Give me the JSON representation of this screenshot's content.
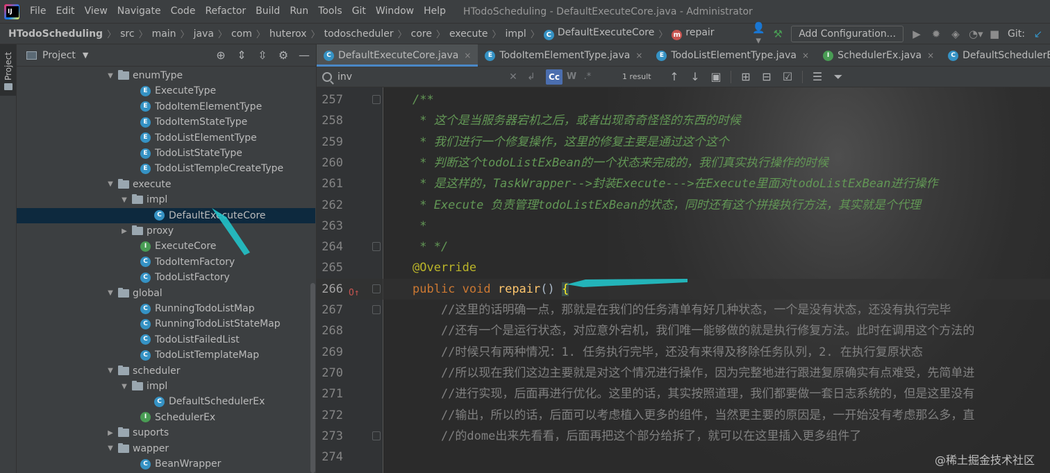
{
  "menu": {
    "items": [
      "File",
      "Edit",
      "View",
      "Navigate",
      "Code",
      "Refactor",
      "Build",
      "Run",
      "Tools",
      "Git",
      "Window",
      "Help"
    ],
    "window_title": "HTodoScheduling - DefaultExecuteCore.java - Administrator"
  },
  "navbar": {
    "crumbs": [
      "HTodoScheduling",
      "src",
      "main",
      "java",
      "com",
      "huterox",
      "todoscheduler",
      "core",
      "execute",
      "impl"
    ],
    "class_crumb": "DefaultExecuteCore",
    "method_crumb": "repair",
    "add_config_label": "Add Configuration...",
    "git_label": "Git:"
  },
  "left_strip": {
    "project_label": "Project"
  },
  "project_panel": {
    "title": "Project",
    "tree": [
      {
        "label": "enumType",
        "kind": "folder",
        "depth": 1,
        "expanded": true
      },
      {
        "label": "ExecuteType",
        "kind": "E",
        "depth": 2
      },
      {
        "label": "TodoItemElementType",
        "kind": "E",
        "depth": 2
      },
      {
        "label": "TodoItemStateType",
        "kind": "E",
        "depth": 2
      },
      {
        "label": "TodoListElementType",
        "kind": "E",
        "depth": 2
      },
      {
        "label": "TodoListStateType",
        "kind": "E",
        "depth": 2
      },
      {
        "label": "TodoListTempleCreateType",
        "kind": "E",
        "depth": 2
      },
      {
        "label": "execute",
        "kind": "folder",
        "depth": 1,
        "expanded": true
      },
      {
        "label": "impl",
        "kind": "folder",
        "depth": 2,
        "expanded": true
      },
      {
        "label": "DefaultExecuteCore",
        "kind": "C",
        "depth": 3,
        "selected": true
      },
      {
        "label": "proxy",
        "kind": "folder",
        "depth": 2,
        "expanded": false
      },
      {
        "label": "ExecuteCore",
        "kind": "I",
        "depth": 2
      },
      {
        "label": "TodoItemFactory",
        "kind": "C",
        "depth": 2
      },
      {
        "label": "TodoListFactory",
        "kind": "C",
        "depth": 2
      },
      {
        "label": "global",
        "kind": "folder",
        "depth": 1,
        "expanded": true
      },
      {
        "label": "RunningTodoListMap",
        "kind": "C",
        "depth": 2
      },
      {
        "label": "RunningTodoListStateMap",
        "kind": "C",
        "depth": 2
      },
      {
        "label": "TodoListFailedList",
        "kind": "C",
        "depth": 2
      },
      {
        "label": "TodoListTemplateMap",
        "kind": "C",
        "depth": 2
      },
      {
        "label": "scheduler",
        "kind": "folder",
        "depth": 1,
        "expanded": true
      },
      {
        "label": "impl",
        "kind": "folder",
        "depth": 2,
        "expanded": true
      },
      {
        "label": "DefaultSchedulerEx",
        "kind": "C",
        "depth": 3
      },
      {
        "label": "SchedulerEx",
        "kind": "I",
        "depth": 2
      },
      {
        "label": "suports",
        "kind": "folder",
        "depth": 1,
        "expanded": false
      },
      {
        "label": "wapper",
        "kind": "folder",
        "depth": 1,
        "expanded": true
      },
      {
        "label": "BeanWrapper",
        "kind": "C",
        "depth": 2
      }
    ]
  },
  "editor": {
    "tabs": [
      {
        "label": "DefaultExecuteCore.java",
        "kind": "C",
        "active": true
      },
      {
        "label": "TodoItemElementType.java",
        "kind": "E"
      },
      {
        "label": "TodoListElementType.java",
        "kind": "E"
      },
      {
        "label": "SchedulerEx.java",
        "kind": "I"
      },
      {
        "label": "DefaultSchedulerEx.java",
        "kind": "C"
      }
    ],
    "search": {
      "value": "inv",
      "match_case_label": "Cc",
      "words_label": "W",
      "regex_label": ".*",
      "result": "1 result"
    },
    "lines": [
      {
        "num": "257",
        "fold": true,
        "parts": [
          {
            "t": "/**",
            "c": "c-comment"
          }
        ]
      },
      {
        "num": "258",
        "parts": [
          {
            "t": " * 这个是当服务器宕机之后，或者出现奇奇怪怪的东西的时候",
            "c": "c-comment"
          }
        ]
      },
      {
        "num": "259",
        "parts": [
          {
            "t": " * 我们进行一个修复操作，这里的修复主要是通过这个这个",
            "c": "c-comment"
          }
        ]
      },
      {
        "num": "260",
        "parts": [
          {
            "t": " * 判断这个todoListExBean的一个状态来完成的，我们真实执行操作的时候",
            "c": "c-comment"
          }
        ]
      },
      {
        "num": "261",
        "parts": [
          {
            "t": " * 是这样的，TaskWrapper-->封装Execute--->在Execute里面对todoListExBean进行操作",
            "c": "c-comment"
          }
        ]
      },
      {
        "num": "262",
        "parts": [
          {
            "t": " * Execute 负责管理todoListExBean的状态，同时还有这个拼接执行方法，其实就是个代理",
            "c": "c-comment"
          }
        ]
      },
      {
        "num": "263",
        "parts": [
          {
            "t": " *",
            "c": "c-comment"
          }
        ]
      },
      {
        "num": "264",
        "fold": true,
        "parts": [
          {
            "t": " * */",
            "c": "c-comment"
          }
        ]
      },
      {
        "num": "265",
        "parts": [
          {
            "t": "@Override",
            "c": "c-annot"
          }
        ]
      },
      {
        "num": "266",
        "current": true,
        "mark": "O↑",
        "fold": true,
        "parts": [
          {
            "t": "public ",
            "c": "c-kw"
          },
          {
            "t": "void ",
            "c": "c-kw"
          },
          {
            "t": "repair",
            "c": "c-fn"
          },
          {
            "t": "() ",
            "c": "c-plain"
          },
          {
            "t": "{",
            "c": "c-brace"
          }
        ]
      },
      {
        "num": "267",
        "fold": true,
        "parts": [
          {
            "t": "    //这里的话明确一点，那就是在我们的任务清单有好几种状态，一个是没有状态，还没有执行完毕",
            "c": "c-line-comment"
          }
        ]
      },
      {
        "num": "268",
        "parts": [
          {
            "t": "    //还有一个是运行状态，对应意外宕机，我们唯一能够做的就是执行修复方法。此时在调用这个方法的",
            "c": "c-line-comment"
          }
        ]
      },
      {
        "num": "269",
        "parts": [
          {
            "t": "    //时候只有两种情况：1. 任务执行完毕，还没有来得及移除任务队列，2. 在执行复原状态",
            "c": "c-line-comment"
          }
        ]
      },
      {
        "num": "270",
        "parts": [
          {
            "t": "    //所以现在我们这边主要就是对这个情况进行操作，因为完整地进行跟进复原确实有点难受，先简单进",
            "c": "c-line-comment"
          }
        ]
      },
      {
        "num": "271",
        "parts": [
          {
            "t": "    //进行实现，后面再进行优化。这里的话，其实按照道理，我们都要做一套日志系统的，但是这里没有",
            "c": "c-line-comment"
          }
        ]
      },
      {
        "num": "272",
        "parts": [
          {
            "t": "    //输出，所以的话，后面可以考虑植入更多的组件，当然更主要的原因是，一开始没有考虑那么多，直",
            "c": "c-line-comment"
          }
        ]
      },
      {
        "num": "273",
        "fold": true,
        "parts": [
          {
            "t": "    //的dome出来先看看，后面再把这个部分给拆了，就可以在这里插入更多组件了",
            "c": "c-line-comment"
          }
        ]
      },
      {
        "num": "274",
        "parts": []
      }
    ]
  },
  "watermark": "@稀土掘金技术社区",
  "colors": {
    "accent": "#4a88c7",
    "selection": "#0d293e",
    "arrow": "#22c3c9"
  }
}
